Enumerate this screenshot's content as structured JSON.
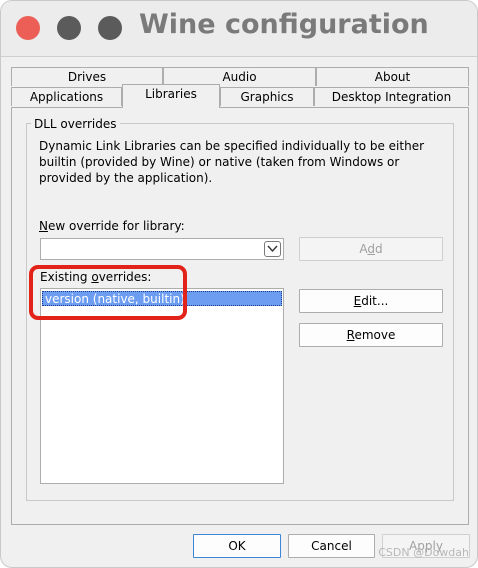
{
  "window": {
    "title": "Wine configuration"
  },
  "tabs": {
    "row1": [
      {
        "label": "Drives"
      },
      {
        "label": "Audio"
      },
      {
        "label": "About"
      }
    ],
    "row2": [
      {
        "label": "Applications"
      },
      {
        "label": "Libraries",
        "active": true
      },
      {
        "label": "Graphics"
      },
      {
        "label": "Desktop Integration"
      }
    ]
  },
  "dll_overrides": {
    "group_title": "DLL overrides",
    "description": "Dynamic Link Libraries can be specified individually to be either builtin (provided by Wine) or native (taken from Windows or provided by the application).",
    "new_override_label_prefix": "N",
    "new_override_label_rest": "ew override for library:",
    "new_override_value": "",
    "add_label_pre": "A",
    "add_label_u": "d",
    "add_label_post": "d",
    "existing_label_pre": "Existing ",
    "existing_label_u": "o",
    "existing_label_post": "verrides:",
    "existing_items": [
      "version (native, builtin)"
    ],
    "edit_label_u": "E",
    "edit_label_post": "dit...",
    "remove_label_u": "R",
    "remove_label_post": "emove"
  },
  "footer": {
    "ok_label": "OK",
    "cancel_label": "Cancel",
    "apply_label": "Apply"
  },
  "watermark": "CSDN @Dowdah",
  "colors": {
    "close_light": "#ec5f57",
    "selection": "#6c9df0",
    "highlight_border": "#e2231a"
  },
  "icons": {
    "combo_dropdown": "chevron-down-icon"
  }
}
